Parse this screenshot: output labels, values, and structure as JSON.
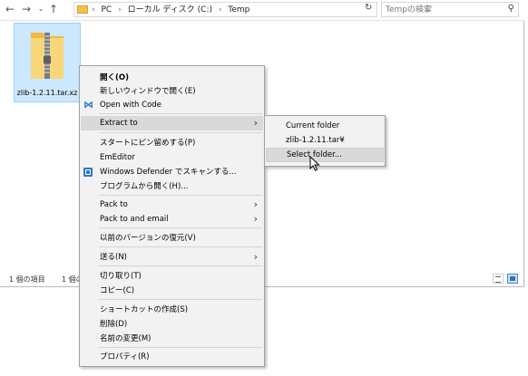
{
  "addressbar": {
    "path": [
      "PC",
      "ローカル ディスク (C:)",
      "Temp"
    ],
    "separator": "›",
    "search_placeholder": "Tempの検索"
  },
  "file": {
    "name": "zlib-1.2.11.tar.xz"
  },
  "status": {
    "count": "1 個の項目",
    "selected": "1 個の"
  },
  "context_menu": {
    "items": [
      {
        "label": "開く(O)",
        "bold": true
      },
      {
        "label": "新しいウィンドウで開く(E)"
      },
      {
        "label": "Open with Code",
        "icon": "vscode-icon"
      },
      {
        "label": "Extract to",
        "submenu": true
      },
      {
        "label": "スタートにピン留めする(P)"
      },
      {
        "label": "EmEditor"
      },
      {
        "label": "Windows Defender でスキャンする...",
        "icon": "windows-defender-icon"
      },
      {
        "label": "プログラムから開く(H)..."
      },
      {
        "label": "Pack to",
        "submenu": true
      },
      {
        "label": "Pack to and email",
        "submenu": true
      },
      {
        "label": "以前のバージョンの復元(V)"
      },
      {
        "label": "送る(N)",
        "submenu": true
      },
      {
        "label": "切り取り(T)"
      },
      {
        "label": "コピー(C)"
      },
      {
        "label": "ショートカットの作成(S)"
      },
      {
        "label": "削除(D)"
      },
      {
        "label": "名前の変更(M)"
      },
      {
        "label": "プロパティ(R)"
      }
    ]
  },
  "submenu": {
    "items": [
      {
        "label": "Current folder"
      },
      {
        "label": "zlib-1.2.11.tar¥"
      },
      {
        "label": "Select folder..."
      }
    ]
  },
  "colors": {
    "selection": "#cce8ff",
    "menu_bg": "#f2f2f2",
    "menu_hover": "#d9d9d9",
    "folder": "#f3c24e"
  }
}
